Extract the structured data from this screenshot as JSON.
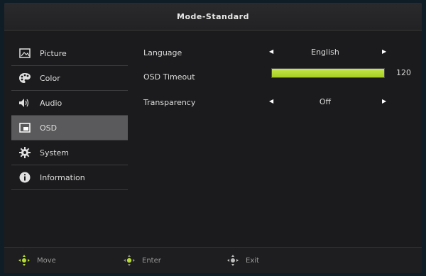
{
  "header": {
    "title": "Mode-Standard"
  },
  "sidebar": {
    "items": [
      {
        "label": "Picture",
        "icon": "picture-icon",
        "active": false
      },
      {
        "label": "Color",
        "icon": "palette-icon",
        "active": false
      },
      {
        "label": "Audio",
        "icon": "speaker-icon",
        "active": false
      },
      {
        "label": "OSD",
        "icon": "osd-icon",
        "active": true
      },
      {
        "label": "System",
        "icon": "gear-icon",
        "active": false
      },
      {
        "label": "Information",
        "icon": "info-icon",
        "active": false
      }
    ]
  },
  "settings": {
    "language": {
      "label": "Language",
      "value": "English"
    },
    "osd_timeout": {
      "label": "OSD Timeout",
      "value": "120",
      "fill_fraction": 1.0
    },
    "transparency": {
      "label": "Transparency",
      "value": "Off"
    }
  },
  "footer": {
    "move": "Move",
    "enter": "Enter",
    "exit": "Exit"
  },
  "colors": {
    "accent_green": "#b6dc33",
    "active_bg": "#5a5a5c"
  }
}
